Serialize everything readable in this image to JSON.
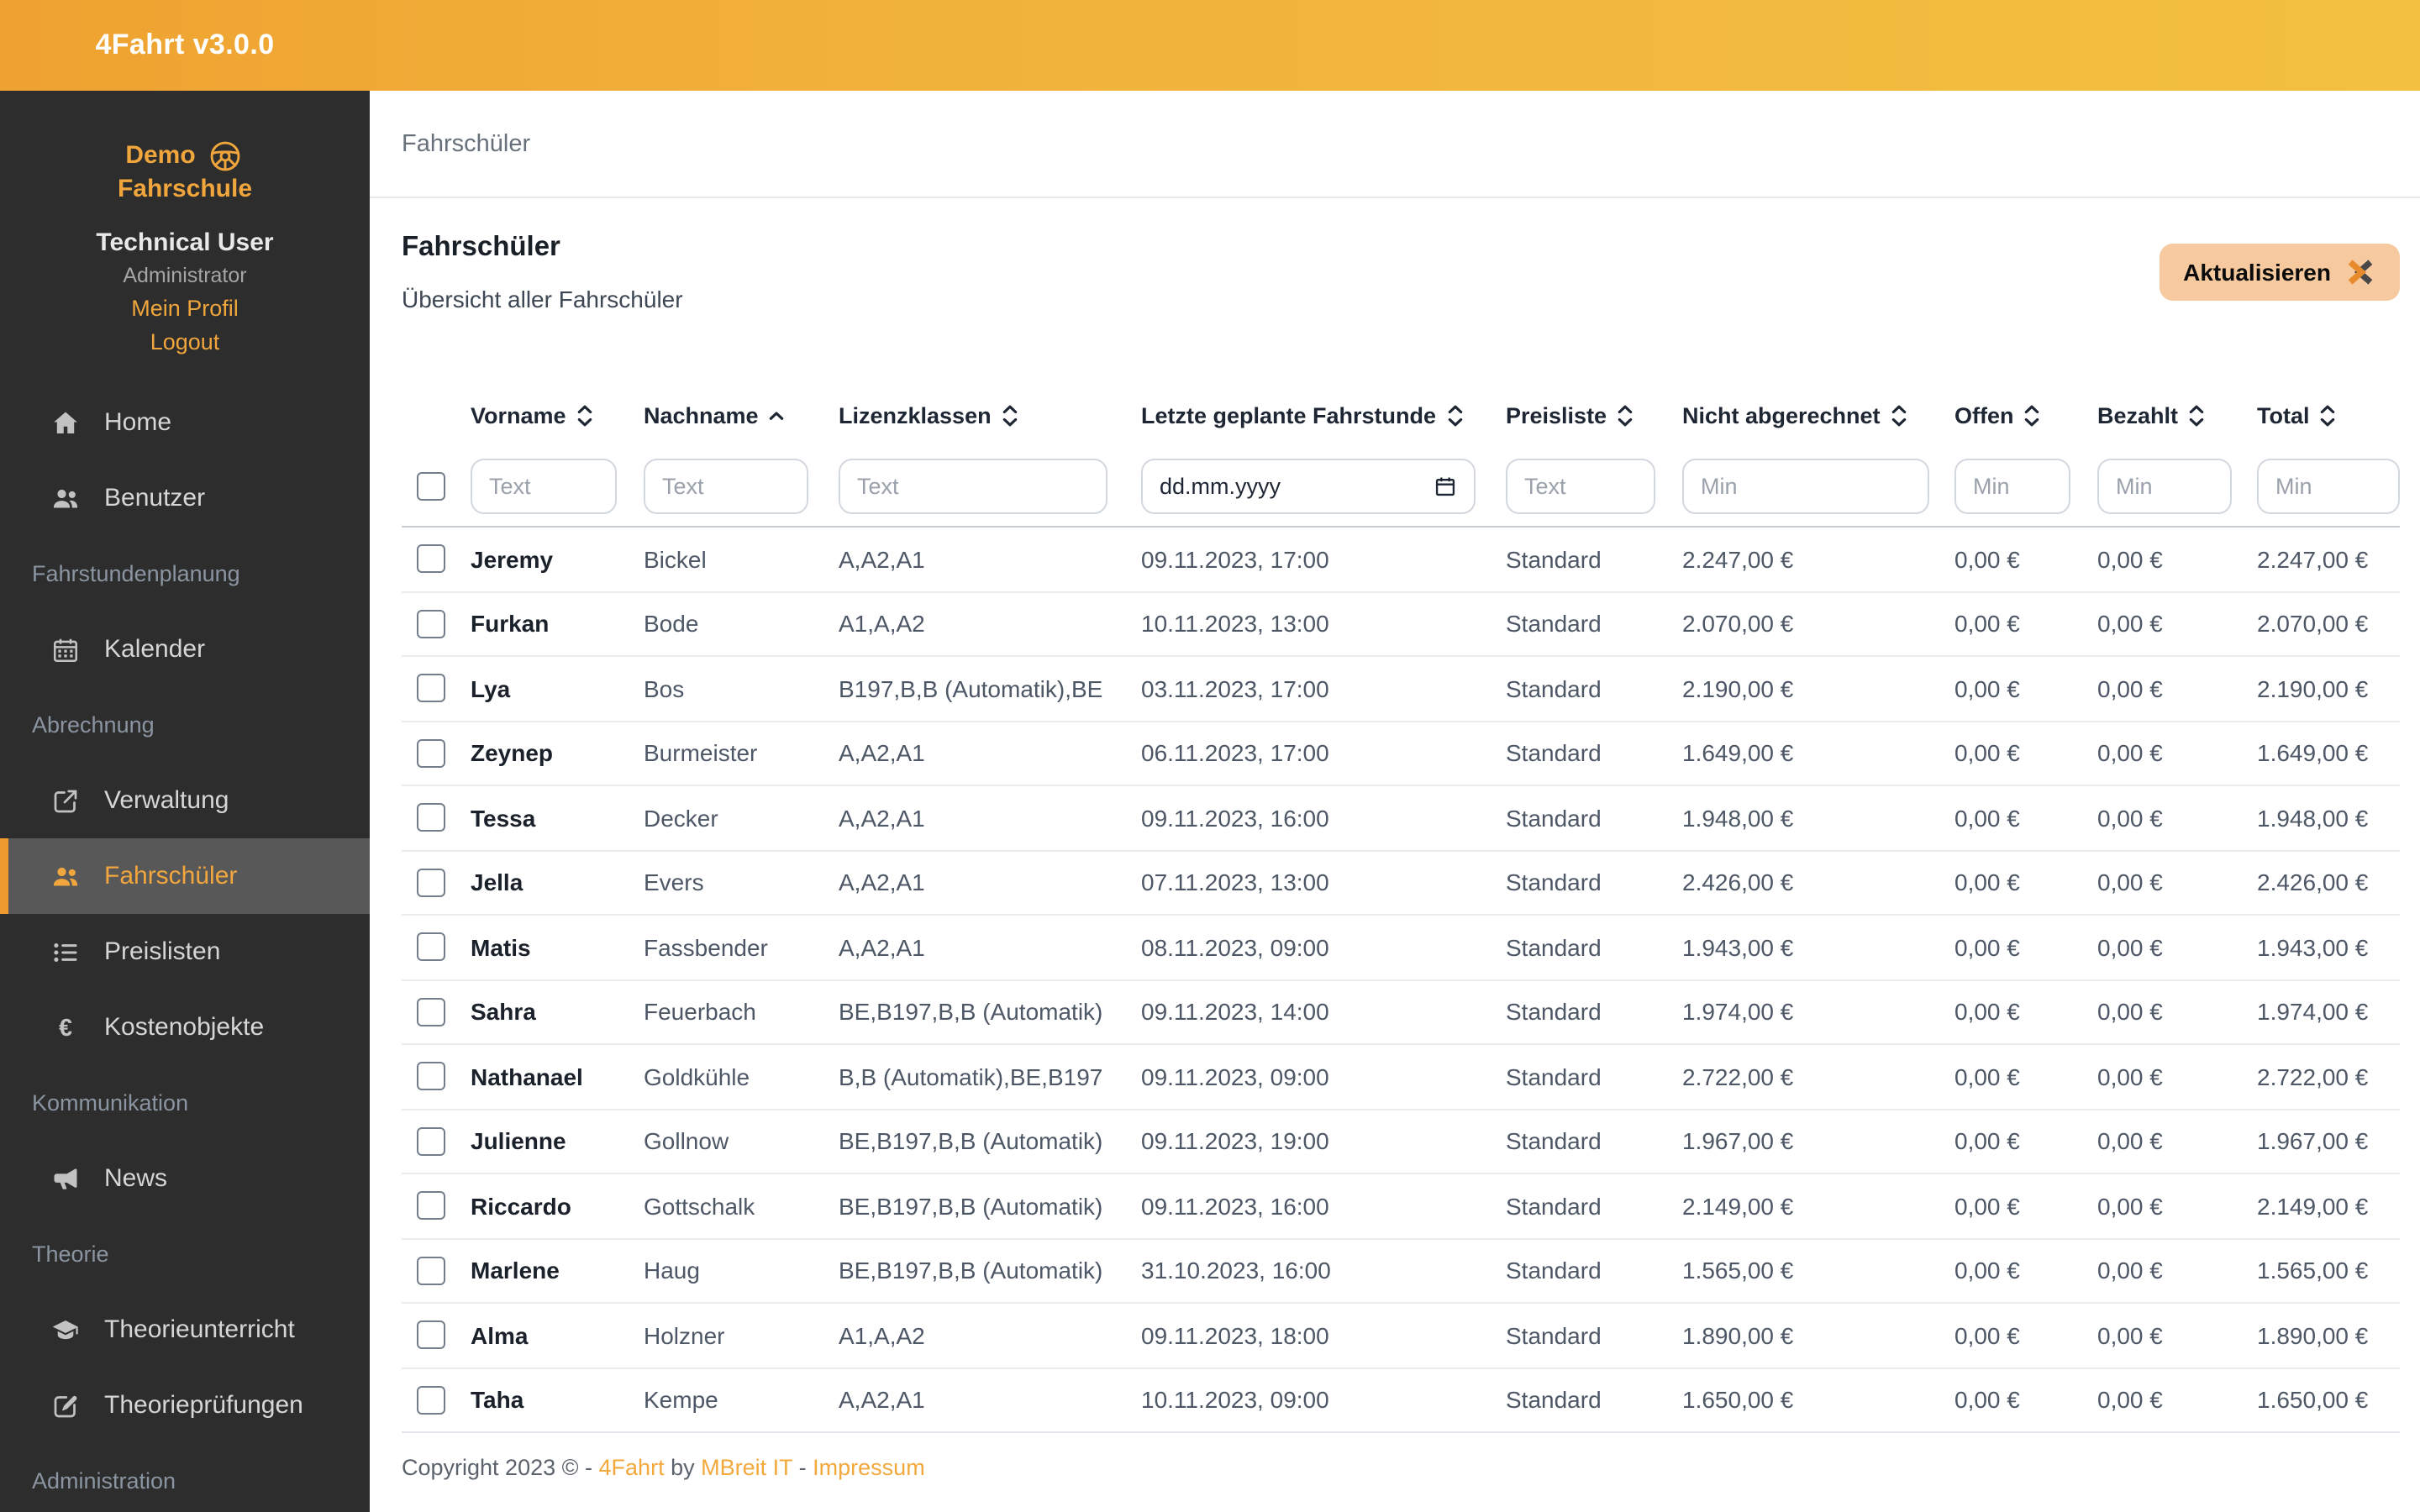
{
  "app": {
    "title": "4Fahrt v3.0.0"
  },
  "accent_colors": {
    "orange": "#f0a63c",
    "topbar_left": "#efa231",
    "topbar_right": "#f3c041",
    "button_bg": "#f6c99e",
    "sidebar_bg": "#2d2d2d",
    "active_item_bg": "#585858"
  },
  "sidebar": {
    "logo": {
      "line1": "Demo",
      "line2": "Fahrschule",
      "icon": "steering-wheel-icon"
    },
    "user": {
      "name": "Technical User",
      "role": "Administrator",
      "profile_link": "Mein Profil",
      "logout_link": "Logout"
    },
    "nav": [
      {
        "type": "item",
        "label": "Home",
        "icon": "home-icon",
        "active": false
      },
      {
        "type": "item",
        "label": "Benutzer",
        "icon": "users-icon",
        "active": false
      },
      {
        "type": "section",
        "label": "Fahrstundenplanung"
      },
      {
        "type": "item",
        "label": "Kalender",
        "icon": "calendar-icon",
        "active": false
      },
      {
        "type": "section",
        "label": "Abrechnung"
      },
      {
        "type": "item",
        "label": "Verwaltung",
        "icon": "external-link-icon",
        "active": false
      },
      {
        "type": "item",
        "label": "Fahrschüler",
        "icon": "users-icon",
        "active": true
      },
      {
        "type": "item",
        "label": "Preislisten",
        "icon": "list-icon",
        "active": false
      },
      {
        "type": "item",
        "label": "Kostenobjekte",
        "icon": "euro-icon",
        "active": false
      },
      {
        "type": "section",
        "label": "Kommunikation"
      },
      {
        "type": "item",
        "label": "News",
        "icon": "megaphone-icon",
        "active": false
      },
      {
        "type": "section",
        "label": "Theorie"
      },
      {
        "type": "item",
        "label": "Theorieunterricht",
        "icon": "graduation-cap-icon",
        "active": false
      },
      {
        "type": "item",
        "label": "Theorieprüfungen",
        "icon": "edit-icon",
        "active": false
      },
      {
        "type": "section",
        "label": "Administration"
      }
    ]
  },
  "breadcrumb": "Fahrschüler",
  "page": {
    "title": "Fahrschüler",
    "subtitle": "Übersicht aller Fahrschüler",
    "refresh_label": "Aktualisieren",
    "refresh_icon": "brand-x-icon"
  },
  "table": {
    "columns": [
      {
        "label": "Vorname",
        "sort": "both",
        "filter_placeholder": "Text",
        "filter_type": "text",
        "input_width": 87
      },
      {
        "label": "Nachname",
        "sort": "asc",
        "filter_placeholder": "Text",
        "filter_type": "text",
        "input_width": 98
      },
      {
        "label": "Lizenzklassen",
        "sort": "both",
        "filter_placeholder": "Text",
        "filter_type": "text",
        "input_width": 160
      },
      {
        "label": "Letzte geplante Fahrstunde",
        "sort": "both",
        "filter_placeholder": "dd.mm.yyyy",
        "filter_type": "date",
        "input_width": 199
      },
      {
        "label": "Preisliste",
        "sort": "both",
        "filter_placeholder": "Text",
        "filter_type": "text",
        "input_width": 89
      },
      {
        "label": "Nicht abgerechnet",
        "sort": "both",
        "filter_placeholder": "Min",
        "filter_type": "text",
        "input_width": 147
      },
      {
        "label": "Offen",
        "sort": "both",
        "filter_placeholder": "Min",
        "filter_type": "text",
        "input_width": 69
      },
      {
        "label": "Bezahlt",
        "sort": "both",
        "filter_placeholder": "Min",
        "filter_type": "text",
        "input_width": 80
      },
      {
        "label": "Total",
        "sort": "both",
        "filter_placeholder": "Min",
        "filter_type": "text",
        "input_width": 85
      }
    ],
    "rows": [
      [
        "Jeremy",
        "Bickel",
        "A,A2,A1",
        "09.11.2023, 17:00",
        "Standard",
        "2.247,00 €",
        "0,00 €",
        "0,00 €",
        "2.247,00 €"
      ],
      [
        "Furkan",
        "Bode",
        "A1,A,A2",
        "10.11.2023, 13:00",
        "Standard",
        "2.070,00 €",
        "0,00 €",
        "0,00 €",
        "2.070,00 €"
      ],
      [
        "Lya",
        "Bos",
        "B197,B,B (Automatik),BE",
        "03.11.2023, 17:00",
        "Standard",
        "2.190,00 €",
        "0,00 €",
        "0,00 €",
        "2.190,00 €"
      ],
      [
        "Zeynep",
        "Burmeister",
        "A,A2,A1",
        "06.11.2023, 17:00",
        "Standard",
        "1.649,00 €",
        "0,00 €",
        "0,00 €",
        "1.649,00 €"
      ],
      [
        "Tessa",
        "Decker",
        "A,A2,A1",
        "09.11.2023, 16:00",
        "Standard",
        "1.948,00 €",
        "0,00 €",
        "0,00 €",
        "1.948,00 €"
      ],
      [
        "Jella",
        "Evers",
        "A,A2,A1",
        "07.11.2023, 13:00",
        "Standard",
        "2.426,00 €",
        "0,00 €",
        "0,00 €",
        "2.426,00 €"
      ],
      [
        "Matis",
        "Fassbender",
        "A,A2,A1",
        "08.11.2023, 09:00",
        "Standard",
        "1.943,00 €",
        "0,00 €",
        "0,00 €",
        "1.943,00 €"
      ],
      [
        "Sahra",
        "Feuerbach",
        "BE,B197,B,B (Automatik)",
        "09.11.2023, 14:00",
        "Standard",
        "1.974,00 €",
        "0,00 €",
        "0,00 €",
        "1.974,00 €"
      ],
      [
        "Nathanael",
        "Goldkühle",
        "B,B (Automatik),BE,B197",
        "09.11.2023, 09:00",
        "Standard",
        "2.722,00 €",
        "0,00 €",
        "0,00 €",
        "2.722,00 €"
      ],
      [
        "Julienne",
        "Gollnow",
        "BE,B197,B,B (Automatik)",
        "09.11.2023, 19:00",
        "Standard",
        "1.967,00 €",
        "0,00 €",
        "0,00 €",
        "1.967,00 €"
      ],
      [
        "Riccardo",
        "Gottschalk",
        "BE,B197,B,B (Automatik)",
        "09.11.2023, 16:00",
        "Standard",
        "2.149,00 €",
        "0,00 €",
        "0,00 €",
        "2.149,00 €"
      ],
      [
        "Marlene",
        "Haug",
        "BE,B197,B,B (Automatik)",
        "31.10.2023, 16:00",
        "Standard",
        "1.565,00 €",
        "0,00 €",
        "0,00 €",
        "1.565,00 €"
      ],
      [
        "Alma",
        "Holzner",
        "A1,A,A2",
        "09.11.2023, 18:00",
        "Standard",
        "1.890,00 €",
        "0,00 €",
        "0,00 €",
        "1.890,00 €"
      ],
      [
        "Taha",
        "Kempe",
        "A,A2,A1",
        "10.11.2023, 09:00",
        "Standard",
        "1.650,00 €",
        "0,00 €",
        "0,00 €",
        "1.650,00 €"
      ]
    ]
  },
  "footer": {
    "segments": [
      {
        "text": "Copyright 2023 © - ",
        "link": false
      },
      {
        "text": "4Fahrt",
        "link": true
      },
      {
        "text": " by ",
        "link": false
      },
      {
        "text": "MBreit IT",
        "link": true
      },
      {
        "text": " - ",
        "link": false
      },
      {
        "text": "Impressum",
        "link": true
      }
    ]
  }
}
